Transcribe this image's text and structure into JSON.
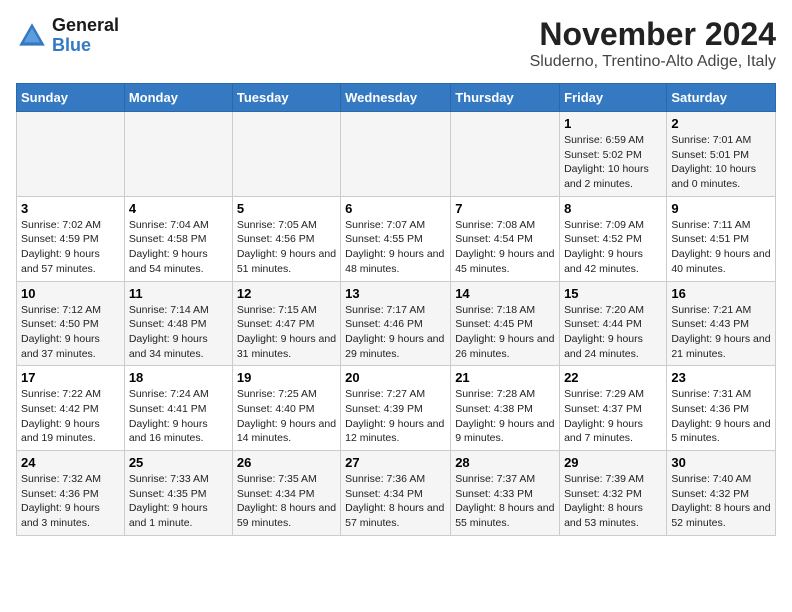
{
  "logo": {
    "line1": "General",
    "line2": "Blue"
  },
  "title": "November 2024",
  "location": "Sluderno, Trentino-Alto Adige, Italy",
  "days_of_week": [
    "Sunday",
    "Monday",
    "Tuesday",
    "Wednesday",
    "Thursday",
    "Friday",
    "Saturday"
  ],
  "weeks": [
    [
      {
        "day": "",
        "info": ""
      },
      {
        "day": "",
        "info": ""
      },
      {
        "day": "",
        "info": ""
      },
      {
        "day": "",
        "info": ""
      },
      {
        "day": "",
        "info": ""
      },
      {
        "day": "1",
        "info": "Sunrise: 6:59 AM\nSunset: 5:02 PM\nDaylight: 10 hours and 2 minutes."
      },
      {
        "day": "2",
        "info": "Sunrise: 7:01 AM\nSunset: 5:01 PM\nDaylight: 10 hours and 0 minutes."
      }
    ],
    [
      {
        "day": "3",
        "info": "Sunrise: 7:02 AM\nSunset: 4:59 PM\nDaylight: 9 hours and 57 minutes."
      },
      {
        "day": "4",
        "info": "Sunrise: 7:04 AM\nSunset: 4:58 PM\nDaylight: 9 hours and 54 minutes."
      },
      {
        "day": "5",
        "info": "Sunrise: 7:05 AM\nSunset: 4:56 PM\nDaylight: 9 hours and 51 minutes."
      },
      {
        "day": "6",
        "info": "Sunrise: 7:07 AM\nSunset: 4:55 PM\nDaylight: 9 hours and 48 minutes."
      },
      {
        "day": "7",
        "info": "Sunrise: 7:08 AM\nSunset: 4:54 PM\nDaylight: 9 hours and 45 minutes."
      },
      {
        "day": "8",
        "info": "Sunrise: 7:09 AM\nSunset: 4:52 PM\nDaylight: 9 hours and 42 minutes."
      },
      {
        "day": "9",
        "info": "Sunrise: 7:11 AM\nSunset: 4:51 PM\nDaylight: 9 hours and 40 minutes."
      }
    ],
    [
      {
        "day": "10",
        "info": "Sunrise: 7:12 AM\nSunset: 4:50 PM\nDaylight: 9 hours and 37 minutes."
      },
      {
        "day": "11",
        "info": "Sunrise: 7:14 AM\nSunset: 4:48 PM\nDaylight: 9 hours and 34 minutes."
      },
      {
        "day": "12",
        "info": "Sunrise: 7:15 AM\nSunset: 4:47 PM\nDaylight: 9 hours and 31 minutes."
      },
      {
        "day": "13",
        "info": "Sunrise: 7:17 AM\nSunset: 4:46 PM\nDaylight: 9 hours and 29 minutes."
      },
      {
        "day": "14",
        "info": "Sunrise: 7:18 AM\nSunset: 4:45 PM\nDaylight: 9 hours and 26 minutes."
      },
      {
        "day": "15",
        "info": "Sunrise: 7:20 AM\nSunset: 4:44 PM\nDaylight: 9 hours and 24 minutes."
      },
      {
        "day": "16",
        "info": "Sunrise: 7:21 AM\nSunset: 4:43 PM\nDaylight: 9 hours and 21 minutes."
      }
    ],
    [
      {
        "day": "17",
        "info": "Sunrise: 7:22 AM\nSunset: 4:42 PM\nDaylight: 9 hours and 19 minutes."
      },
      {
        "day": "18",
        "info": "Sunrise: 7:24 AM\nSunset: 4:41 PM\nDaylight: 9 hours and 16 minutes."
      },
      {
        "day": "19",
        "info": "Sunrise: 7:25 AM\nSunset: 4:40 PM\nDaylight: 9 hours and 14 minutes."
      },
      {
        "day": "20",
        "info": "Sunrise: 7:27 AM\nSunset: 4:39 PM\nDaylight: 9 hours and 12 minutes."
      },
      {
        "day": "21",
        "info": "Sunrise: 7:28 AM\nSunset: 4:38 PM\nDaylight: 9 hours and 9 minutes."
      },
      {
        "day": "22",
        "info": "Sunrise: 7:29 AM\nSunset: 4:37 PM\nDaylight: 9 hours and 7 minutes."
      },
      {
        "day": "23",
        "info": "Sunrise: 7:31 AM\nSunset: 4:36 PM\nDaylight: 9 hours and 5 minutes."
      }
    ],
    [
      {
        "day": "24",
        "info": "Sunrise: 7:32 AM\nSunset: 4:36 PM\nDaylight: 9 hours and 3 minutes."
      },
      {
        "day": "25",
        "info": "Sunrise: 7:33 AM\nSunset: 4:35 PM\nDaylight: 9 hours and 1 minute."
      },
      {
        "day": "26",
        "info": "Sunrise: 7:35 AM\nSunset: 4:34 PM\nDaylight: 8 hours and 59 minutes."
      },
      {
        "day": "27",
        "info": "Sunrise: 7:36 AM\nSunset: 4:34 PM\nDaylight: 8 hours and 57 minutes."
      },
      {
        "day": "28",
        "info": "Sunrise: 7:37 AM\nSunset: 4:33 PM\nDaylight: 8 hours and 55 minutes."
      },
      {
        "day": "29",
        "info": "Sunrise: 7:39 AM\nSunset: 4:32 PM\nDaylight: 8 hours and 53 minutes."
      },
      {
        "day": "30",
        "info": "Sunrise: 7:40 AM\nSunset: 4:32 PM\nDaylight: 8 hours and 52 minutes."
      }
    ]
  ]
}
